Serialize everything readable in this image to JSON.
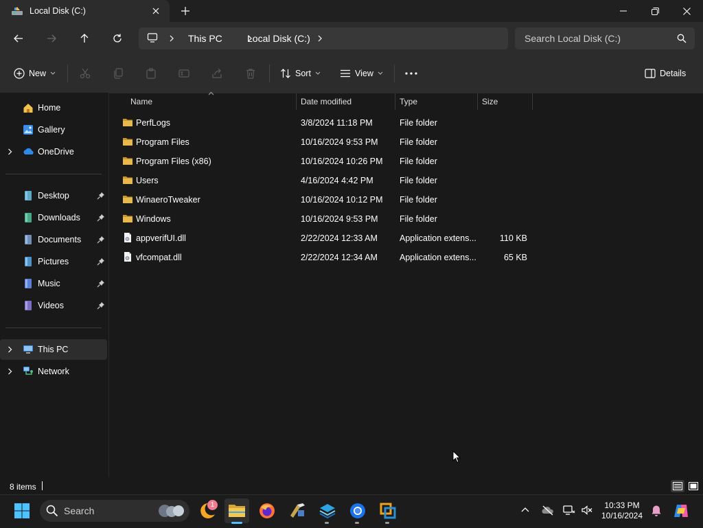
{
  "window": {
    "tab_title": "Local Disk (C:)"
  },
  "address": {
    "crumbs": [
      "This PC",
      "Local Disk (C:)"
    ],
    "search_placeholder": "Search Local Disk (C:)"
  },
  "toolbar": {
    "new_label": "New",
    "sort_label": "Sort",
    "view_label": "View",
    "details_label": "Details"
  },
  "sidebar": {
    "top_items": [
      {
        "label": "Home",
        "icon": "home-icon"
      },
      {
        "label": "Gallery",
        "icon": "gallery-icon"
      },
      {
        "label": "OneDrive",
        "icon": "onedrive-icon"
      }
    ],
    "quick_access": [
      {
        "label": "Desktop",
        "icon": "desktop-icon"
      },
      {
        "label": "Downloads",
        "icon": "downloads-icon"
      },
      {
        "label": "Documents",
        "icon": "documents-icon"
      },
      {
        "label": "Pictures",
        "icon": "pictures-icon"
      },
      {
        "label": "Music",
        "icon": "music-icon"
      },
      {
        "label": "Videos",
        "icon": "videos-icon"
      }
    ],
    "devices": [
      {
        "label": "This PC",
        "icon": "this-pc-icon"
      },
      {
        "label": "Network",
        "icon": "network-icon"
      }
    ]
  },
  "columns": {
    "name": "Name",
    "date": "Date modified",
    "type": "Type",
    "size": "Size"
  },
  "files": [
    {
      "name": "PerfLogs",
      "date": "3/8/2024 11:18 PM",
      "type": "File folder",
      "size": "",
      "icon": "folder-icon"
    },
    {
      "name": "Program Files",
      "date": "10/16/2024 9:53 PM",
      "type": "File folder",
      "size": "",
      "icon": "folder-icon"
    },
    {
      "name": "Program Files (x86)",
      "date": "10/16/2024 10:26 PM",
      "type": "File folder",
      "size": "",
      "icon": "folder-icon"
    },
    {
      "name": "Users",
      "date": "4/16/2024 4:42 PM",
      "type": "File folder",
      "size": "",
      "icon": "folder-icon"
    },
    {
      "name": "WinaeroTweaker",
      "date": "10/16/2024 10:12 PM",
      "type": "File folder",
      "size": "",
      "icon": "folder-icon"
    },
    {
      "name": "Windows",
      "date": "10/16/2024 9:53 PM",
      "type": "File folder",
      "size": "",
      "icon": "folder-icon"
    },
    {
      "name": "appverifUI.dll",
      "date": "2/22/2024 12:33 AM",
      "type": "Application extens...",
      "size": "110 KB",
      "icon": "dll-file-icon"
    },
    {
      "name": "vfcompat.dll",
      "date": "2/22/2024 12:34 AM",
      "type": "Application extens...",
      "size": "65 KB",
      "icon": "dll-file-icon"
    }
  ],
  "status": {
    "item_count": "8 items"
  },
  "taskbar": {
    "search_label": "Search",
    "time": "10:33 PM",
    "date": "10/16/2024",
    "badge_count": "1"
  },
  "colors": {
    "folder": "#e8b84a",
    "accent": "#4cc2ff",
    "background": "#191919",
    "chrome": "#2c2c2c"
  }
}
